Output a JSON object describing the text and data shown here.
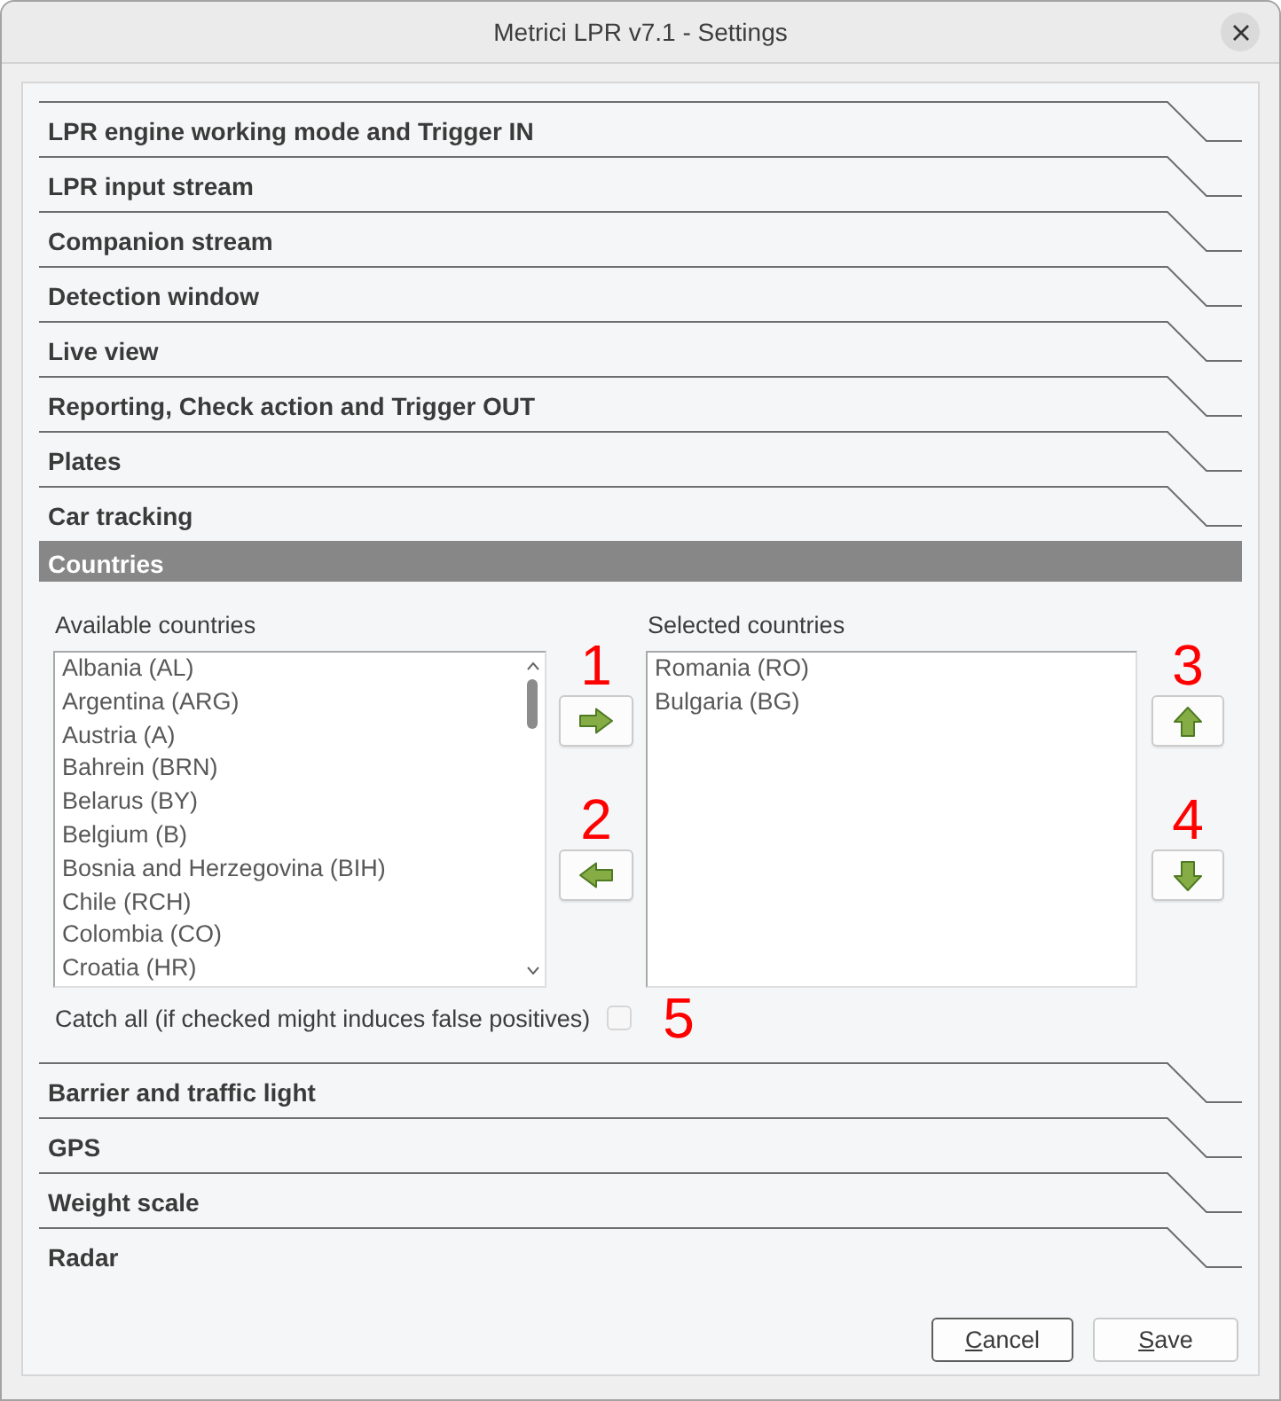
{
  "window": {
    "title": "Metrici LPR v7.1 - Settings"
  },
  "sections": [
    {
      "title": "LPR engine working mode and Trigger IN",
      "expanded": false
    },
    {
      "title": "LPR input stream",
      "expanded": false
    },
    {
      "title": "Companion stream",
      "expanded": false
    },
    {
      "title": "Detection window",
      "expanded": false
    },
    {
      "title": "Live view",
      "expanded": false
    },
    {
      "title": "Reporting, Check action and Trigger OUT",
      "expanded": false
    },
    {
      "title": "Plates",
      "expanded": false
    },
    {
      "title": "Car tracking",
      "expanded": false
    },
    {
      "title": "Countries",
      "expanded": true,
      "content": {
        "available": {
          "label": "Available countries",
          "items": [
            {
              "text": "Albania (AL)",
              "selected": false
            },
            {
              "text": "Argentina (ARG)",
              "selected": false
            },
            {
              "text": "Austria (A)",
              "selected": false
            },
            {
              "text": "Bahrein (BRN)",
              "selected": false
            },
            {
              "text": "Belarus (BY)",
              "selected": false
            },
            {
              "text": "Belgium (B)",
              "selected": false
            },
            {
              "text": "Bosnia and Herzegovina (BIH)",
              "selected": false
            },
            {
              "text": "Chile (RCH)",
              "selected": false
            },
            {
              "text": "Colombia (CO)",
              "selected": false
            },
            {
              "text": "Croatia (HR)",
              "selected": false
            }
          ]
        },
        "transfer_buttons": [
          {
            "kind": "right",
            "callout": "1"
          },
          {
            "kind": "left",
            "callout": "2"
          }
        ],
        "selected": {
          "label": "Selected countries",
          "items": [
            {
              "text": "Romania (RO)",
              "selected": false
            },
            {
              "text": "Bulgaria (BG)",
              "selected": false
            }
          ]
        },
        "order_buttons": [
          {
            "kind": "up",
            "callout": "3"
          },
          {
            "kind": "down",
            "callout": "4"
          }
        ],
        "catch_all": {
          "label": "Catch all (if checked might induces false positives)",
          "checked": false,
          "callout": "5"
        }
      }
    },
    {
      "title": "Barrier and traffic light",
      "expanded": false
    },
    {
      "title": "GPS",
      "expanded": false
    },
    {
      "title": "Weight scale",
      "expanded": false
    },
    {
      "title": "Radar",
      "expanded": false
    }
  ],
  "buttons": [
    {
      "label": "Cancel",
      "default": true,
      "mnemonic": true
    },
    {
      "label": "Save",
      "default": false,
      "mnemonic": true
    }
  ]
}
